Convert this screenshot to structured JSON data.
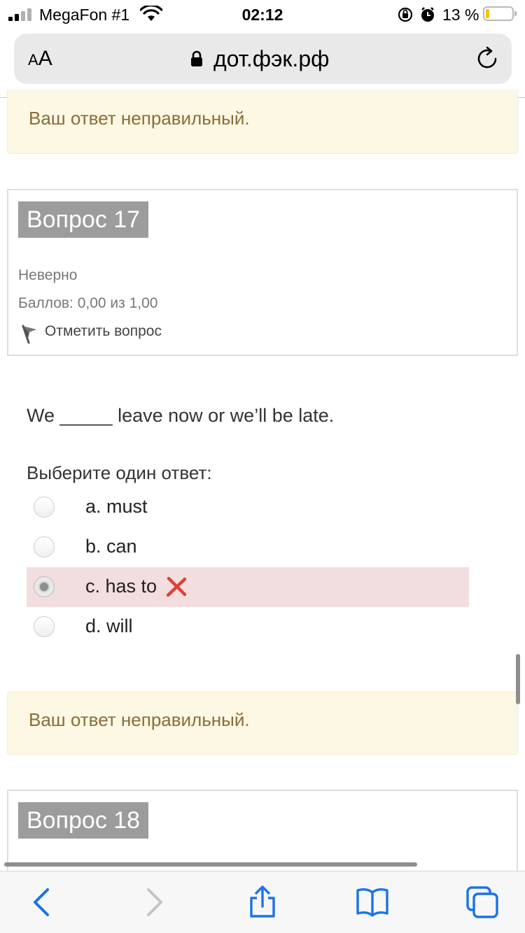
{
  "status_bar": {
    "carrier": "MegaFon #1",
    "time": "02:12",
    "battery_text": "13 %",
    "battery_level": 0.13,
    "battery_color": "#f2c500"
  },
  "browser": {
    "text_size_label_small": "A",
    "text_size_label_large": "A",
    "domain": "дот.фэк.рф",
    "icons": [
      "lock-icon",
      "reload-icon"
    ]
  },
  "feedback_top": {
    "text": "Ваш ответ неправильный."
  },
  "question17": {
    "number_label": "Вопрос 17",
    "state": "Неверно",
    "grade": "Баллов: 0,00 из 1,00",
    "flag_label": "Отметить вопрос",
    "text": "We _____ leave now or we’ll be late.",
    "prompt": "Выберите один ответ:",
    "answers": [
      {
        "label": "a. must",
        "selected": false
      },
      {
        "label": "b. can",
        "selected": false
      },
      {
        "label": "c. has to",
        "selected": true,
        "incorrect": true
      },
      {
        "label": "d. will",
        "selected": false
      }
    ],
    "incorrect_color": "#f2dede",
    "mark_color": "#e0403a"
  },
  "feedback_bottom": {
    "text": "Ваш ответ неправильный."
  },
  "question18": {
    "number_label": "Вопрос 18"
  },
  "toolbar": {
    "icons": [
      "back-icon",
      "forward-icon",
      "share-icon",
      "bookmarks-icon",
      "tabs-icon"
    ],
    "accent_color": "#1a73e8"
  }
}
